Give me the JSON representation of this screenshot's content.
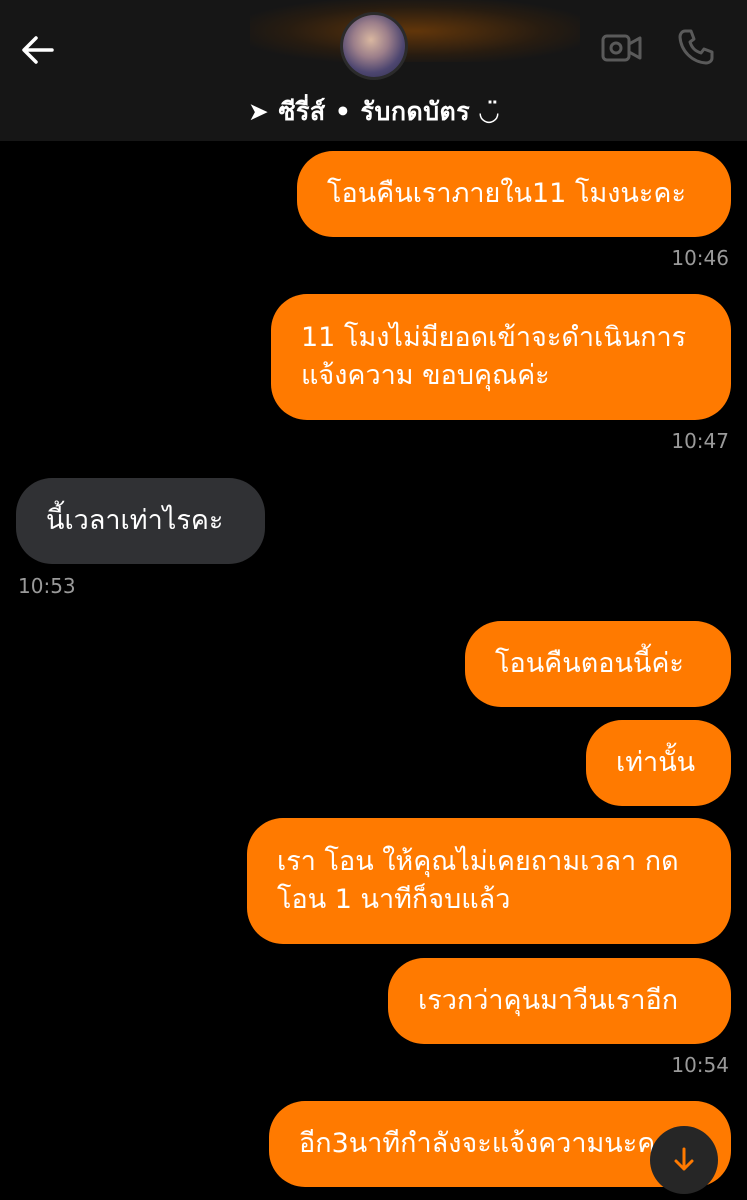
{
  "header": {
    "title": "➤ ซีรี่ส์ • รับกดบัตร ◡̈",
    "back_icon": "arrow-left-icon",
    "video_icon": "video-camera-icon",
    "call_icon": "phone-icon"
  },
  "messages": [
    {
      "text": "โอนคืนเราภายใน11 โมงนะคะ",
      "time": "10:46"
    },
    {
      "text": "11 โมงไม่มียอดเข้าจะดำเนินการแจ้งความ ขอบคุณค่ะ",
      "time": "10:47"
    },
    {
      "text": "นี้เวลาเท่าไรคะ",
      "time": "10:53"
    },
    {
      "text": "โอนคืนตอนนี้ค่ะ"
    },
    {
      "text": "เท่านั้น"
    },
    {
      "text": "เรา โอน ให้คุณไม่เคยถามเวลา กด โอน 1 นาทีก็จบแล้ว"
    },
    {
      "text": "เรวกว่าคุนมาวีนเราอีก",
      "time": "10:54"
    },
    {
      "text": "อีก3นาทีกำลังจะแจ้งความนะคะ"
    }
  ],
  "colors": {
    "outgoing_bubble": "#ff7a00",
    "incoming_bubble": "#303134",
    "background": "#000000",
    "header": "#161616"
  },
  "scroll_icon": "arrow-down-icon"
}
